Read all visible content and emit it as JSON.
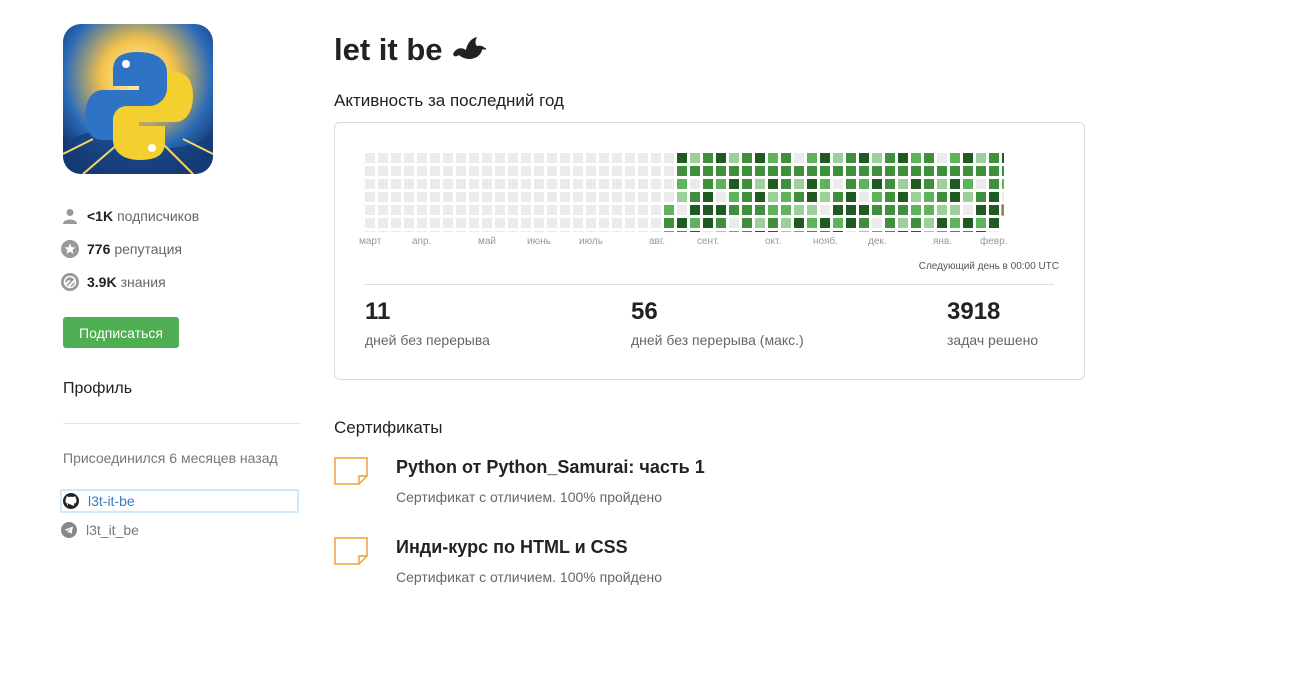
{
  "profile": {
    "name": "let it be",
    "stats": [
      {
        "value": "<1K",
        "label": "подписчиков",
        "icon": "user-icon"
      },
      {
        "value": "776",
        "label": "репутация",
        "icon": "star-icon"
      },
      {
        "value": "3.9K",
        "label": "знания",
        "icon": "knowledge-icon"
      }
    ],
    "follow_label": "Подписаться",
    "section_title": "Профиль",
    "joined": "Присоединился 6 месяцев назад",
    "links": [
      {
        "label": "l3t-it-be",
        "icon": "github-icon"
      },
      {
        "label": "l3t_it_be",
        "icon": "telegram-icon"
      }
    ]
  },
  "activity": {
    "title": "Активность за последний год",
    "months": [
      "март",
      "апр.",
      "май",
      "июнь",
      "июль",
      "авг.",
      "сент.",
      "окт.",
      "нояб.",
      "дек.",
      "янв.",
      "февр."
    ],
    "next_day": "Следующий день в 00:00 UTC",
    "metrics": [
      {
        "value": "11",
        "label": "дней без перерыва"
      },
      {
        "value": "56",
        "label": "дней без перерыва (макс.)"
      },
      {
        "value": "3918",
        "label": "задач решено"
      }
    ],
    "colors": {
      "empty": "#ebebeb",
      "l1": "#9ccf99",
      "l2": "#5fb35b",
      "l3": "#3f8f3c",
      "l4": "#1f5a22",
      "today_border": "#c0392b"
    }
  },
  "certificates": {
    "title": "Сертификаты",
    "items": [
      {
        "title": "Python от Python_Samurai: часть 1",
        "subtitle": "Сертификат с отличием. 100% пройдено"
      },
      {
        "title": "Инди-курс по HTML и CSS",
        "subtitle": "Сертификат с отличием. 100% пройдено"
      }
    ]
  }
}
